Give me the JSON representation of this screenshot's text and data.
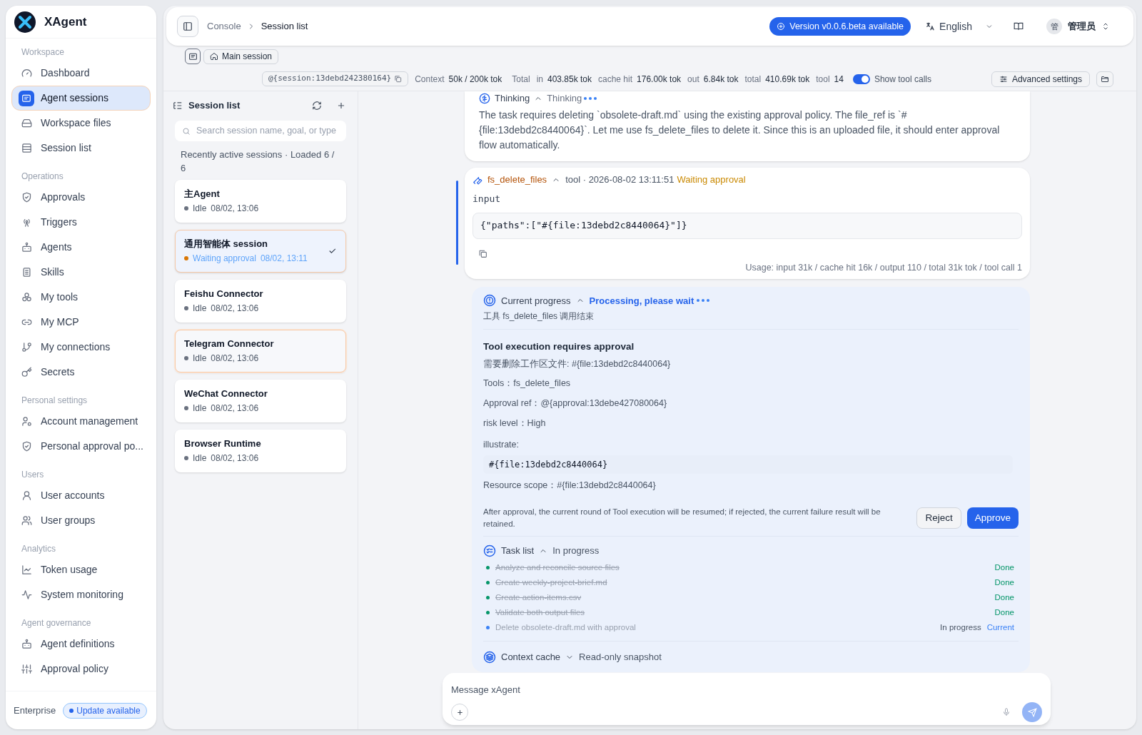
{
  "sidebar": {
    "brand": "XAgent",
    "sections": [
      {
        "title": "Workspace",
        "items": [
          {
            "label": "Dashboard",
            "selected": false
          },
          {
            "label": "Agent sessions",
            "selected": true
          },
          {
            "label": "Workspace files",
            "selected": false
          },
          {
            "label": "Session list",
            "selected": false
          }
        ]
      },
      {
        "title": "Operations",
        "items": [
          {
            "label": "Approvals",
            "selected": false
          },
          {
            "label": "Triggers",
            "selected": false
          },
          {
            "label": "Agents",
            "selected": false
          },
          {
            "label": "Skills",
            "selected": false
          },
          {
            "label": "My tools",
            "selected": false
          },
          {
            "label": "My MCP",
            "selected": false
          },
          {
            "label": "My connections",
            "selected": false
          },
          {
            "label": "Secrets",
            "selected": false
          }
        ]
      },
      {
        "title": "Personal settings",
        "items": [
          {
            "label": "Account management",
            "selected": false
          },
          {
            "label": "Personal approval po...",
            "selected": false
          }
        ]
      },
      {
        "title": "Users",
        "items": [
          {
            "label": "User accounts",
            "selected": false
          },
          {
            "label": "User groups",
            "selected": false
          }
        ]
      },
      {
        "title": "Analytics",
        "items": [
          {
            "label": "Token usage",
            "selected": false
          },
          {
            "label": "System monitoring",
            "selected": false
          }
        ]
      },
      {
        "title": "Agent governance",
        "items": [
          {
            "label": "Agent definitions",
            "selected": false
          },
          {
            "label": "Approval policy",
            "selected": false
          }
        ]
      }
    ],
    "footer": {
      "edition": "Enterprise",
      "badge": "Update available"
    }
  },
  "header": {
    "breadcrumbs": [
      "Console",
      "Session list"
    ],
    "version_badge": "Version v0.0.6.beta available",
    "language": "English",
    "user": {
      "avatar": "管",
      "name": "管理员"
    }
  },
  "session_bar": {
    "main_session": "Main session",
    "session_ref": "@{session:13debd242380164}",
    "context": {
      "label": "Context",
      "value": "50k / 200k tok"
    },
    "totals": {
      "label": "Total",
      "items": [
        {
          "label": "in",
          "value": "403.85k tok"
        },
        {
          "label": "cache hit",
          "value": "176.00k tok"
        },
        {
          "label": "out",
          "value": "6.84k tok"
        },
        {
          "label": "total",
          "value": "410.69k tok"
        }
      ]
    },
    "tool": {
      "label": "tool",
      "value": "14"
    },
    "show_tool_calls": {
      "label": "Show tool calls",
      "on": true
    },
    "advanced_settings": "Advanced settings"
  },
  "session_list": {
    "title": "Session list",
    "search": {
      "placeholder": "Search session name, goal, or type"
    },
    "summary": "Recently active sessions · Loaded 6 / 6",
    "sessions": [
      {
        "name": "主Agent",
        "status": "Idle",
        "time": "08/02, 13:06",
        "color": "#6b7280",
        "selected": false,
        "hovered": false
      },
      {
        "name": "通用智能体 session",
        "status": "Waiting approval",
        "time": "08/02, 13:11",
        "color": "#d97706",
        "selected": true,
        "hovered": false
      },
      {
        "name": "Feishu Connector",
        "status": "Idle",
        "time": "08/02, 13:06",
        "color": "#6b7280",
        "selected": false,
        "hovered": false
      },
      {
        "name": "Telegram Connector",
        "status": "Idle",
        "time": "08/02, 13:06",
        "color": "#6b7280",
        "selected": false,
        "hovered": true
      },
      {
        "name": "WeChat Connector",
        "status": "Idle",
        "time": "08/02, 13:06",
        "color": "#6b7280",
        "selected": false,
        "hovered": false
      },
      {
        "name": "Browser Runtime",
        "status": "Idle",
        "time": "08/02, 13:06",
        "color": "#6b7280",
        "selected": false,
        "hovered": false
      }
    ]
  },
  "chat": {
    "thinking": {
      "title": "Thinking",
      "state": "Thinking",
      "text": "The task requires deleting `obsolete-draft.md` using the existing approval policy. The file_ref is `#{file:13debd2c8440064}`. Let me use fs_delete_files to delete it. Since this is an uploaded file, it should enter approval flow automatically."
    },
    "tool_call": {
      "name": "fs_delete_files",
      "meta": "tool · 2026-08-02 13:11:51",
      "status": "Waiting approval",
      "input_label": "input",
      "input": "{\"paths\":[\"#{file:13debd2c8440064}\"]}",
      "usage": "Usage: input 31k / cache hit 16k / output 110 / total 31k tok / tool call 1"
    },
    "progress": {
      "title": "Current progress",
      "status": "Processing, please wait",
      "subtitle": "工具 fs_delete_files 调用结束",
      "approval": {
        "title": "Tool execution requires approval",
        "description": "需要删除工作区文件: #{file:13debd2c8440064}",
        "fields": [
          "Tools：fs_delete_files",
          "Approval ref：@{approval:13debe427080064}",
          "risk level：High"
        ],
        "illustrate_label": "illustrate:",
        "illustrate_code": "#{file:13debd2c8440064}",
        "scope": "Resource scope：#{file:13debd2c8440064}",
        "note": "After approval, the current round of Tool execution will be resumed; if rejected, the current failure result will be retained.",
        "reject": "Reject",
        "approve": "Approve"
      }
    },
    "task_list": {
      "title": "Task list",
      "state": "In progress",
      "tasks": [
        {
          "label": "Analyze and reconcile source files",
          "kind": "done",
          "status": "Done"
        },
        {
          "label": "Create weekly-project-brief.md",
          "kind": "done",
          "status": "Done"
        },
        {
          "label": "Create action-items.csv",
          "kind": "done",
          "status": "Done"
        },
        {
          "label": "Validate both output files",
          "kind": "done",
          "status": "Done"
        },
        {
          "label": "Delete obsolete-draft.md with approval",
          "kind": "current",
          "status": "In progress",
          "tag": "Current"
        }
      ]
    },
    "context_cache": {
      "title": "Context cache",
      "state": "Read-only snapshot"
    },
    "composer": {
      "placeholder": "Message xAgent"
    }
  }
}
